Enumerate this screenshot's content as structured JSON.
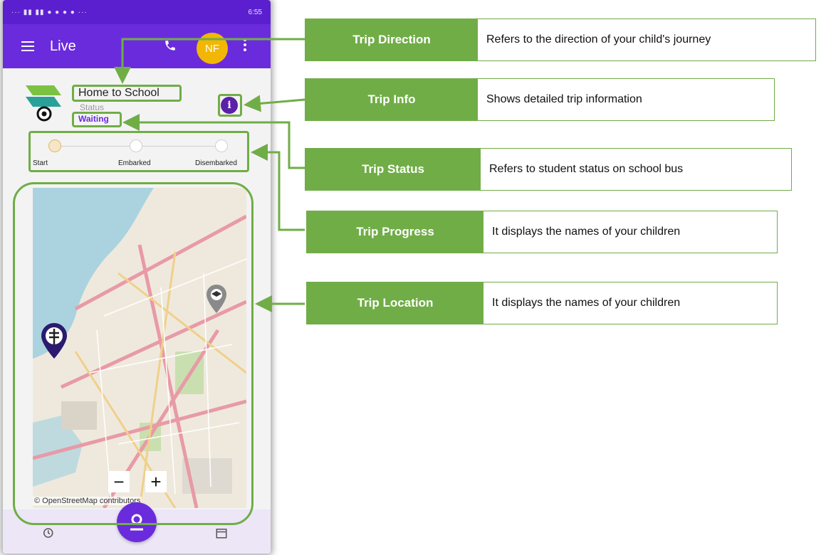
{
  "status_bar": {
    "left_text": "··· ▮▮ ▮▮ ● ● ● ● ···",
    "time": "6:55"
  },
  "app_bar": {
    "title": "Live",
    "avatar_initials": "NF"
  },
  "trip": {
    "direction": "Home to School",
    "status_label": "Status",
    "status_value": "Waiting",
    "info_icon": "i"
  },
  "progress": {
    "steps": [
      "Start",
      "Embarked",
      "Disembarked"
    ],
    "active_step": 0
  },
  "map": {
    "zoom_out": "−",
    "zoom_in": "+",
    "attribution": "© OpenStreetMap contributors"
  },
  "callouts": [
    {
      "label": "Trip Direction",
      "desc": "Refers to the direction of your child's journey"
    },
    {
      "label": "Trip Info",
      "desc": "Shows detailed trip information"
    },
    {
      "label": "Trip Status",
      "desc": "Refers to student status on school bus"
    },
    {
      "label": "Trip Progress",
      "desc": "It displays the names of your children"
    },
    {
      "label": "Trip Location",
      "desc": "It displays the names of your children"
    }
  ],
  "colors": {
    "accent": "#6a2bdc",
    "callout_green": "#70ad47",
    "avatar": "#f2b705"
  },
  "icons": [
    "menu-icon",
    "phone-icon",
    "more-icon",
    "info-icon",
    "school-marker-icon",
    "stop-marker-icon",
    "history-icon",
    "location-icon",
    "calendar-icon"
  ]
}
